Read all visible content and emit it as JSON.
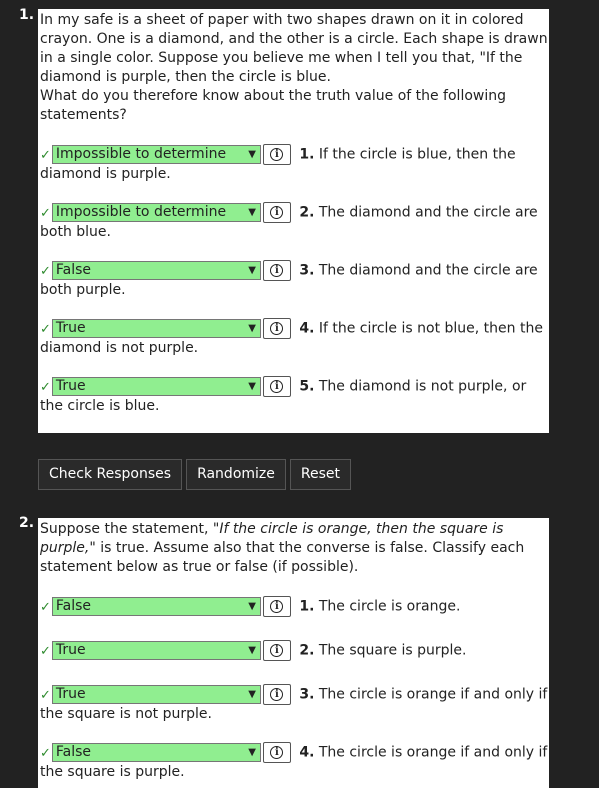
{
  "q1": {
    "number": "1.",
    "prompt_line1": "In my safe is a sheet of paper with two shapes drawn on it in colored crayon. One is a diamond, and the other is a circle. Each shape is drawn in a single color. Suppose you believe me when I tell you that, \"If the diamond is purple, then the circle is blue.",
    "prompt_line2": "What do you therefore know about the truth value of the following statements?",
    "items": [
      {
        "answer": "Impossible to determine",
        "num": "1.",
        "text": "If the circle is blue, then the diamond is purple."
      },
      {
        "answer": "Impossible to determine",
        "num": "2.",
        "text": "The diamond and the circle are both blue."
      },
      {
        "answer": "False",
        "num": "3.",
        "text": "The diamond and the circle are both purple."
      },
      {
        "answer": "True",
        "num": "4.",
        "text": "If the circle is not blue, then the diamond is not purple."
      },
      {
        "answer": "True",
        "num": "5.",
        "text": "The diamond is not purple, or the circle is blue."
      }
    ]
  },
  "buttons": {
    "check": "Check Responses",
    "randomize": "Randomize",
    "reset": "Reset"
  },
  "q2": {
    "number": "2.",
    "prompt_pre": "Suppose the statement, ",
    "prompt_em": "\"If the circle is orange, then the square is purple,\"",
    "prompt_post": " is true. Assume also that the converse is false. Classify each statement below as true or false (if possible).",
    "items": [
      {
        "answer": "False",
        "num": "1.",
        "text": "The circle is orange."
      },
      {
        "answer": "True",
        "num": "2.",
        "text": "The square is purple."
      },
      {
        "answer": "True",
        "num": "3.",
        "text": "The circle is orange if and only if the square is not purple."
      },
      {
        "answer": "False",
        "num": "4.",
        "text": "The circle is orange if and only if the square is purple."
      }
    ]
  },
  "icons": {
    "check": "✓",
    "chevron": "⌄",
    "info": "i"
  }
}
